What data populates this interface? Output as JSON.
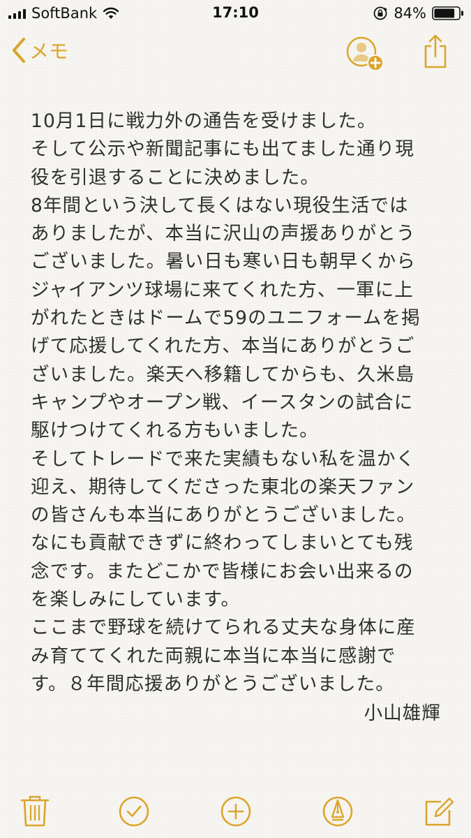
{
  "status_bar": {
    "carrier": "SoftBank",
    "time": "17:10",
    "battery_percent": "84%",
    "battery_level": 0.84
  },
  "nav": {
    "back_label": "メモ"
  },
  "note": {
    "lines": [
      "10月1日に戦力外の通告を受けました。",
      "そして公示や新聞記事にも出てました通り現",
      "役を引退することに決めました。",
      "8年間という決して長くはない現役生活では",
      "ありましたが、本当に沢山の声援ありがとう",
      "ございました。暑い日も寒い日も朝早くから",
      "ジャイアンツ球場に来てくれた方、一軍に上",
      "がれたときはドームで59のユニフォームを掲",
      "げて応援してくれた方、本当にありがとうご",
      "ざいました。楽天へ移籍してからも、久米島",
      "キャンプやオープン戦、イースタンの試合に",
      "駆けつけてくれる方もいました。",
      "そしてトレードで来た実績もない私を温かく",
      "迎え、期待してくださった東北の楽天ファン",
      "の皆さんも本当にありがとうございました。",
      "なにも貢献できずに終わってしまいとても残",
      "念です。またどこかで皆様にお会い出来るの",
      "を楽しみにしています。",
      "ここまで野球を続けてられる丈夫な身体に産",
      "み育ててくれた両親に本当に本当に感謝で",
      "す。８年間応援ありがとうございました。"
    ],
    "signature": "小山雄輝"
  },
  "colors": {
    "accent": "#dba52c",
    "text": "#2f2f2f",
    "paper": "#f6f5f1"
  },
  "icons": {
    "back": "chevron-left-icon",
    "add_person": "add-person-icon",
    "share": "share-icon",
    "trash": "trash-icon",
    "checklist": "checkmark-circle-icon",
    "add": "plus-circle-icon",
    "markup": "pen-tip-circle-icon",
    "compose": "compose-icon"
  }
}
